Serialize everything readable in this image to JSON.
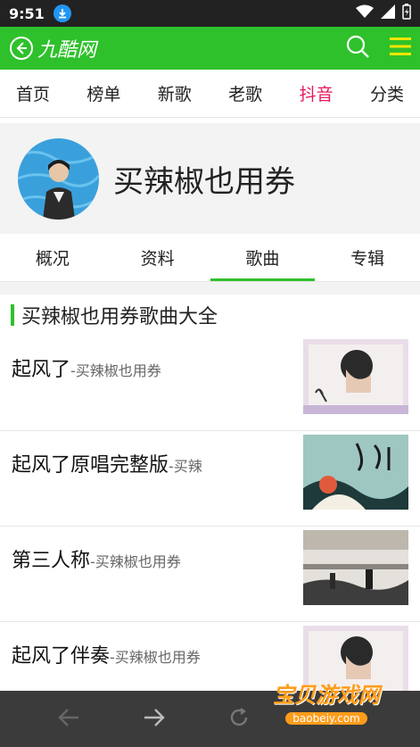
{
  "status": {
    "time": "9:51"
  },
  "header": {
    "title": "九酷网"
  },
  "nav": [
    {
      "label": "首页",
      "active": false
    },
    {
      "label": "榜单",
      "active": false
    },
    {
      "label": "新歌",
      "active": false
    },
    {
      "label": "老歌",
      "active": false
    },
    {
      "label": "抖音",
      "active": true
    },
    {
      "label": "分类",
      "active": false
    }
  ],
  "profile": {
    "name": "买辣椒也用券"
  },
  "tabs": [
    {
      "label": "概况",
      "active": false
    },
    {
      "label": "资料",
      "active": false
    },
    {
      "label": "歌曲",
      "active": true
    },
    {
      "label": "专辑",
      "active": false
    }
  ],
  "section": {
    "title": "买辣椒也用券歌曲大全"
  },
  "songs": [
    {
      "title": "起风了",
      "artist": "-买辣椒也用券"
    },
    {
      "title": "起风了原唱完整版",
      "artist": "-买辣"
    },
    {
      "title": "第三人称",
      "artist": "-买辣椒也用券"
    },
    {
      "title": "起风了伴奏",
      "artist": "-买辣椒也用券"
    }
  ],
  "watermark": {
    "text": "宝贝游戏网",
    "url": "baobeiy.com"
  },
  "colors": {
    "accent": "#2fc12c",
    "active_nav": "#e8185a"
  }
}
